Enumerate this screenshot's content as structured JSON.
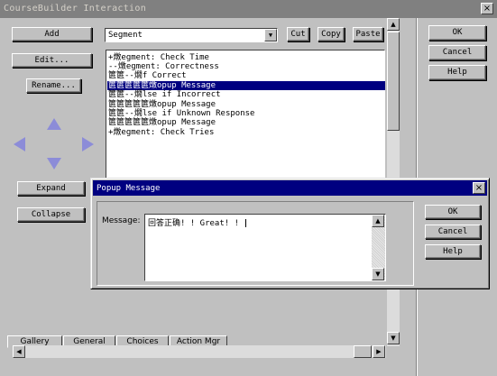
{
  "window": {
    "title": "CourseBuilder Interaction",
    "close_glyph": "×"
  },
  "left_buttons": {
    "add": "Add",
    "edit": "Edit...",
    "rename": "Rename...",
    "expand": "Expand",
    "collapse": "Collapse"
  },
  "nav_arrows": {
    "color": "#8c8cd8"
  },
  "segment_combo": {
    "value": "Segment"
  },
  "edit_buttons": {
    "cut": "Cut",
    "copy": "Copy",
    "paste": "Paste"
  },
  "right_buttons": {
    "ok": "OK",
    "cancel": "Cancel",
    "help": "Help"
  },
  "tree_items": [
    {
      "text": "+燉egment: Check Time",
      "selected": false
    },
    {
      "text": "--燉egment: Correctness",
      "selected": false
    },
    {
      "text": "篋篋--燗f Correct",
      "selected": false
    },
    {
      "text": "篋篋篋篋篋燉opup Message",
      "selected": true
    },
    {
      "text": "篋篋--燗lse if Incorrect",
      "selected": false
    },
    {
      "text": "篋篋篋篋篋燉opup Message",
      "selected": false
    },
    {
      "text": "篋篋--燗lse if Unknown Response",
      "selected": false
    },
    {
      "text": "篋篋篋篋篋燉opup Message",
      "selected": false
    },
    {
      "text": "+燉egment: Check Tries",
      "selected": false
    }
  ],
  "bottom_tabs": [
    "Gallery",
    "General",
    "Choices",
    "Action Mgr"
  ],
  "popup": {
    "title": "Popup Message",
    "close_glyph": "×",
    "message_label": "Message:",
    "message_value": "回答正确! ! Great! ! ",
    "ok": "OK",
    "cancel": "Cancel",
    "help": "Help"
  },
  "colors": {
    "selection": "#000080",
    "title_active": "#000080",
    "title_inactive": "#808080"
  }
}
